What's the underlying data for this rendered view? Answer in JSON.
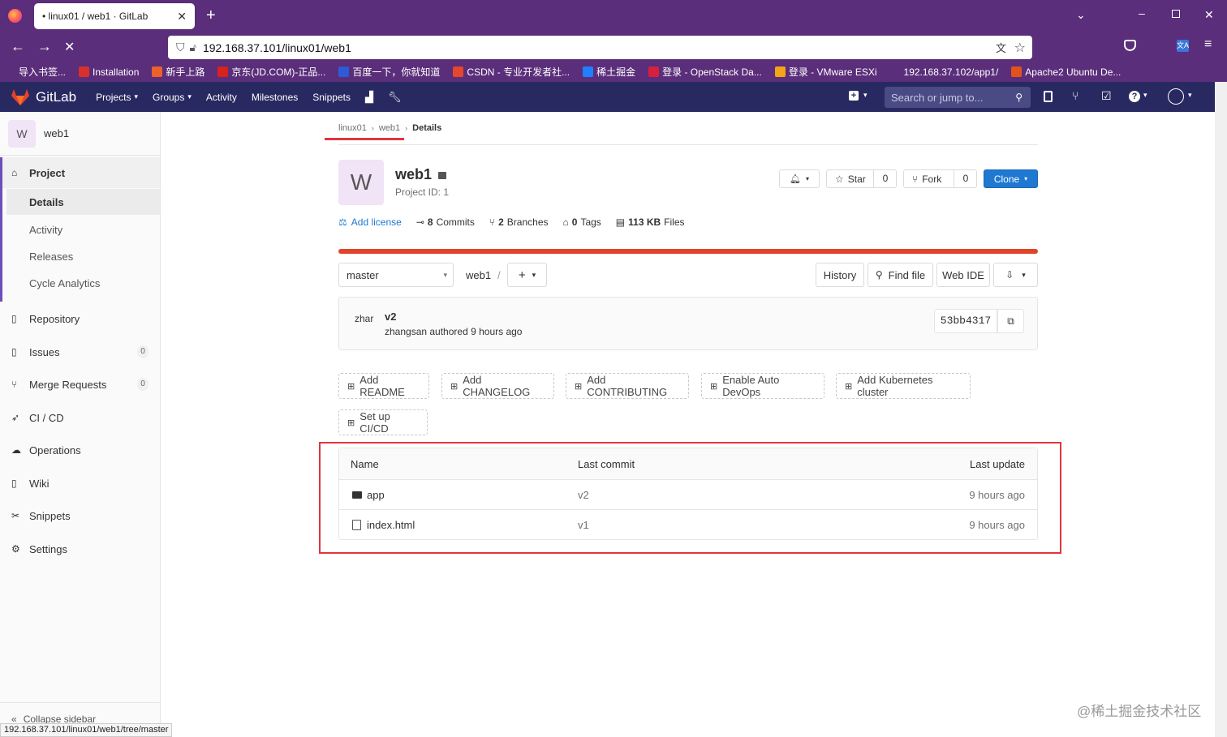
{
  "browser": {
    "tab_title": "• linux01 / web1 · GitLab",
    "url": "192.168.37.101/linux01/web1",
    "status_url": "192.168.37.101/linux01/web1/tree/master",
    "bookmarks": [
      {
        "label": "导入书签...",
        "color": "#5a2e7a"
      },
      {
        "label": "Installation",
        "color": "#d9302b"
      },
      {
        "label": "新手上路",
        "color": "#e8622a"
      },
      {
        "label": "京东(JD.COM)-正品...",
        "color": "#d7231c"
      },
      {
        "label": "百度一下，你就知道",
        "color": "#2d5bd8"
      },
      {
        "label": "CSDN - 专业开发者社...",
        "color": "#e5462e"
      },
      {
        "label": "稀土掘金",
        "color": "#1e80ff"
      },
      {
        "label": "登录 - OpenStack Da...",
        "color": "#d6203e"
      },
      {
        "label": "登录 - VMware ESXi",
        "color": "#f2a516"
      },
      {
        "label": "192.168.37.102/app1/",
        "color": "#5a2e7a"
      },
      {
        "label": "Apache2 Ubuntu De...",
        "color": "#e2521d"
      }
    ]
  },
  "gitlab_header": {
    "brand": "GitLab",
    "nav": [
      "Projects",
      "Groups",
      "Activity",
      "Milestones",
      "Snippets"
    ],
    "search_placeholder": "Search or jump to..."
  },
  "sidebar": {
    "project_initial": "W",
    "project_name": "web1",
    "project_label": "Project",
    "project_subitems": [
      "Details",
      "Activity",
      "Releases",
      "Cycle Analytics"
    ],
    "items": [
      {
        "label": "Repository",
        "icon": "book-icon"
      },
      {
        "label": "Issues",
        "icon": "issues-icon",
        "count": "0"
      },
      {
        "label": "Merge Requests",
        "icon": "merge-request-icon",
        "count": "0"
      },
      {
        "label": "CI / CD",
        "icon": "rocket-icon"
      },
      {
        "label": "Operations",
        "icon": "cloud-gear-icon"
      },
      {
        "label": "Wiki",
        "icon": "book-icon"
      },
      {
        "label": "Snippets",
        "icon": "scissors-icon"
      },
      {
        "label": "Settings",
        "icon": "gear-icon"
      }
    ],
    "collapse_label": "Collapse sidebar"
  },
  "breadcrumb": [
    "linux01",
    "web1",
    "Details"
  ],
  "project": {
    "avatar_initial": "W",
    "name": "web1",
    "project_id": "Project ID: 1",
    "star_label": "Star",
    "star_count": "0",
    "fork_label": "Fork",
    "fork_count": "0",
    "clone_label": "Clone"
  },
  "stats": {
    "add_license": "Add license",
    "commits_num": "8",
    "commits_label": "Commits",
    "branches_num": "2",
    "branches_label": "Branches",
    "tags_num": "0",
    "tags_label": "Tags",
    "files_num": "113 KB",
    "files_label": "Files"
  },
  "repo_bar": {
    "branch": "master",
    "path": "web1",
    "separator": "/",
    "history": "History",
    "find_file": "Find file",
    "web_ide": "Web IDE"
  },
  "last_commit": {
    "avatar_alt": "zhar",
    "title": "v2",
    "meta": "zhangsan authored 9 hours ago",
    "sha": "53bb4317"
  },
  "shortcuts": [
    "Add README",
    "Add CHANGELOG",
    "Add CONTRIBUTING",
    "Enable Auto DevOps",
    "Add Kubernetes cluster",
    "Set up CI/CD"
  ],
  "file_table": {
    "headers": [
      "Name",
      "Last commit",
      "Last update"
    ],
    "rows": [
      {
        "name": "app",
        "type": "folder",
        "commit": "v2",
        "updated": "9 hours ago"
      },
      {
        "name": "index.html",
        "type": "file",
        "commit": "v1",
        "updated": "9 hours ago"
      }
    ]
  },
  "watermark": "@稀土掘金技术社区",
  "colors": {
    "header": "#292961",
    "browser": "#5a2e7a",
    "clone": "#1f78d1",
    "progress": "#e24329",
    "highlight": "#e0353d"
  }
}
